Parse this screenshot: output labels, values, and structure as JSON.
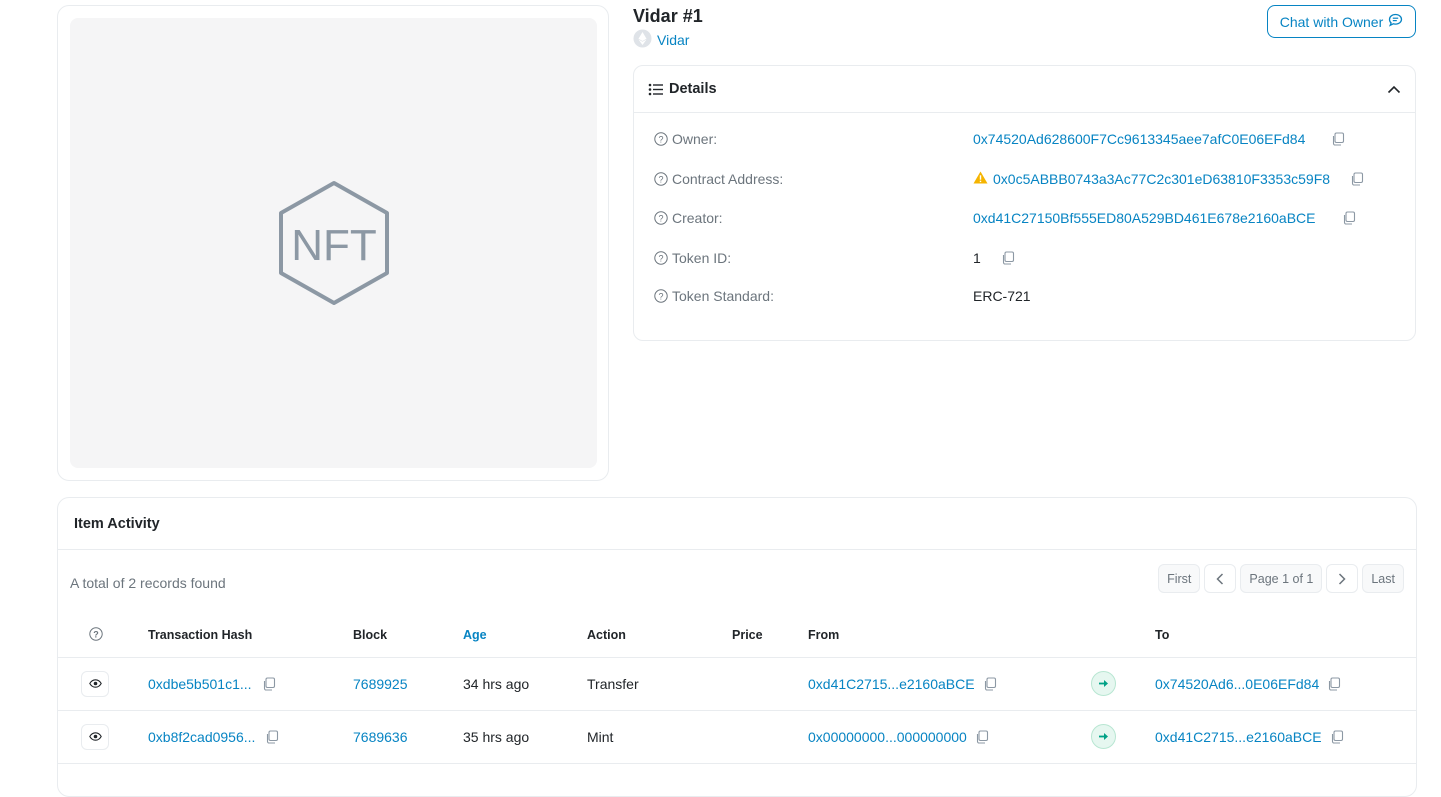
{
  "header": {
    "title": "Vidar #1",
    "collection_name": "Vidar",
    "chat_button_label": "Chat with Owner"
  },
  "image": {
    "placeholder_text": "NFT"
  },
  "details": {
    "heading": "Details",
    "rows": [
      {
        "label": "Owner:",
        "value": "0x74520Ad628600F7Cc9613345aee7afC0E06EFd84"
      },
      {
        "label": "Contract Address:",
        "value": "0x0c5ABBB0743a3Ac77C2c301eD63810F3353c59F8"
      },
      {
        "label": "Creator:",
        "value": "0xd41C27150Bf555ED80A529BD461E678e2160aBCE"
      },
      {
        "label": "Token ID:",
        "value": "1"
      },
      {
        "label": "Token Standard:",
        "value": "ERC-721"
      }
    ]
  },
  "activity": {
    "heading": "Item Activity",
    "records_text": "A total of 2 records found",
    "pager": {
      "first": "First",
      "page": "Page 1 of 1",
      "last": "Last"
    },
    "columns": [
      "Transaction Hash",
      "Block",
      "Age",
      "Action",
      "Price",
      "From",
      "To"
    ],
    "rows": [
      {
        "hash": "0xdbe5b501c1...",
        "block": "7689925",
        "age": "34 hrs ago",
        "action": "Transfer",
        "price": "",
        "from": "0xd41C2715...e2160aBCE",
        "to": "0x74520Ad6...0E06EFd84"
      },
      {
        "hash": "0xb8f2cad0956...",
        "block": "7689636",
        "age": "35 hrs ago",
        "action": "Mint",
        "price": "",
        "from": "0x00000000...000000000",
        "to": "0xd41C2715...e2160aBCE"
      }
    ]
  },
  "colors": {
    "link": "#0784c3",
    "warning": "#f5b400",
    "success": "#00a186"
  }
}
